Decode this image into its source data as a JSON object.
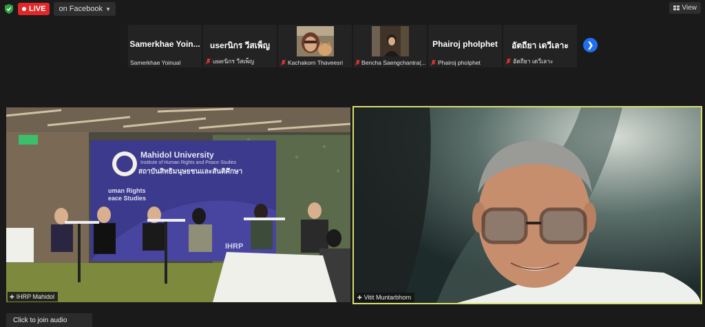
{
  "top_bar": {
    "live_label": "LIVE",
    "stream_target": "on Facebook",
    "view_label": "View"
  },
  "participants_strip": [
    {
      "big_text": "Samerkhae  Yoin...",
      "name": "Samerkhae Yoinual",
      "muted": false,
      "has_video": false
    },
    {
      "big_text": "userนิกร วีสเพ็ญ",
      "name": "userนิกร วีสเพ็ญ",
      "muted": true,
      "has_video": false
    },
    {
      "big_text": "",
      "name": "Kachakorn Thaveesri",
      "muted": true,
      "has_video": true
    },
    {
      "big_text": "",
      "name": "Bencha Saengchantra(...",
      "muted": true,
      "has_video": true
    },
    {
      "big_text": "Phairoj phoIphet",
      "name": "Phairoj phoIphet",
      "muted": true,
      "has_video": false
    },
    {
      "big_text": "อัตถียา เดวีเลาะ",
      "name": "อัตถียา เดวีเลาะ",
      "muted": true,
      "has_video": false
    }
  ],
  "main_videos": {
    "left_name": "IHRP Mahidol",
    "right_name": "Vitit Muntarbhorn"
  },
  "scene": {
    "banner_title": "Mahidol University",
    "banner_subtitle": "Institute of Human Rights and Peace Studies",
    "banner_thai": "สถาบันสิทธิมนุษยชนและสันติศึกษา",
    "banner_side": "uman Rights\neace Studies",
    "banner_small": "IHRP"
  },
  "audio_button": "Click to join audio",
  "colors": {
    "live": "#e02828",
    "active_border": "#d9e06e",
    "arrow": "#1f6ff0",
    "mute": "#e33333"
  }
}
